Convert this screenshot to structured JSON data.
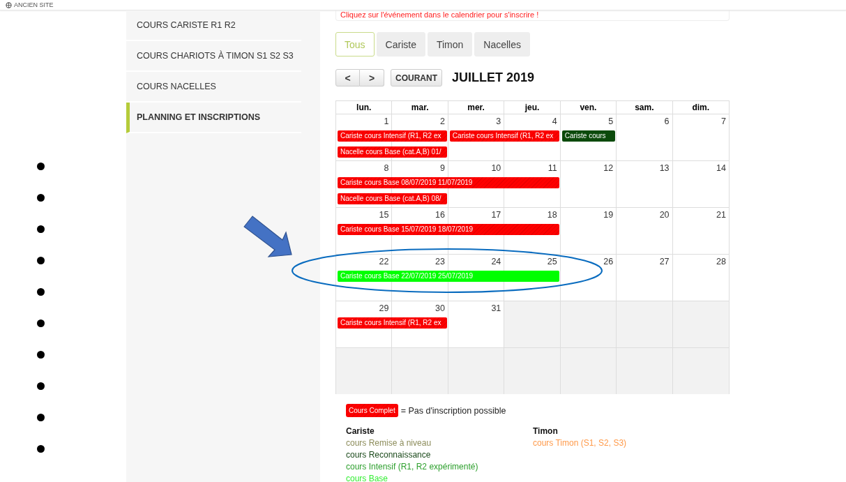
{
  "top_bar": {
    "link": "ANCIEN SITE"
  },
  "sidebar": {
    "items": [
      {
        "label": "COURS CARISTE R1 R2",
        "selected": false
      },
      {
        "label": "COURS CHARIOTS À TIMON S1 S2 S3",
        "selected": false
      },
      {
        "label": "COURS NACELLES",
        "selected": false
      },
      {
        "label": "PLANNING ET INSCRIPTIONS",
        "selected": true
      }
    ]
  },
  "notice": "Cliquez sur l'événement dans le calendrier pour s'inscrire !",
  "filters": [
    {
      "label": "Tous",
      "selected": true
    },
    {
      "label": "Cariste",
      "selected": false
    },
    {
      "label": "Timon",
      "selected": false
    },
    {
      "label": "Nacelles",
      "selected": false
    }
  ],
  "toolbar": {
    "prev": "<",
    "next": ">",
    "today": "COURANT",
    "title": "JUILLET 2019"
  },
  "calendar": {
    "weekdays": [
      "lun.",
      "mar.",
      "mer.",
      "jeu.",
      "ven.",
      "sam.",
      "dim."
    ],
    "weeks": [
      {
        "days": [
          {
            "number": "1",
            "events": [
              {
                "text": "Cariste cours Intensif (R1, R2 ex",
                "kind": "two_day",
                "color": "#ff0000",
                "full": true
              },
              {
                "text": "Nacelle cours Base (cat.A,B) 01/",
                "kind": "two_day",
                "color": "#ff0000",
                "full": true
              }
            ]
          },
          {
            "number": "2"
          },
          {
            "number": "3",
            "events": [
              {
                "text": "Cariste cours Intensif (R1, R2 ex",
                "kind": "two_day",
                "color": "#ff0000",
                "full": true
              }
            ]
          },
          {
            "number": "4"
          },
          {
            "number": "5",
            "events": [
              {
                "text": "Cariste cours",
                "kind": "one_day",
                "color": "#0b4a0b",
                "full": false
              }
            ]
          },
          {
            "number": "6"
          },
          {
            "number": "7"
          }
        ]
      },
      {
        "days": [
          {
            "number": "8",
            "events": [
              {
                "text": "Cariste cours Base 08/07/2019 11/07/2019",
                "kind": "four_day",
                "color": "#ff0000",
                "full": true
              },
              {
                "text": "Nacelle cours Base (cat.A,B) 08/",
                "kind": "two_day",
                "color": "#ff0000",
                "full": true
              }
            ]
          },
          {
            "number": "9"
          },
          {
            "number": "10"
          },
          {
            "number": "11"
          },
          {
            "number": "12"
          },
          {
            "number": "13"
          },
          {
            "number": "14"
          }
        ]
      },
      {
        "days": [
          {
            "number": "15",
            "events": [
              {
                "text": "Cariste cours Base 15/07/2019 18/07/2019",
                "kind": "four_day",
                "color": "#ff0000",
                "full": true
              }
            ]
          },
          {
            "number": "16"
          },
          {
            "number": "17"
          },
          {
            "number": "18"
          },
          {
            "number": "19"
          },
          {
            "number": "20"
          },
          {
            "number": "21"
          }
        ]
      },
      {
        "days": [
          {
            "number": "22",
            "events": [
              {
                "text": "Cariste cours Base 22/07/2019 25/07/2019",
                "kind": "four_day",
                "color": "#00ff00",
                "full": false
              }
            ]
          },
          {
            "number": "23"
          },
          {
            "number": "24"
          },
          {
            "number": "25"
          },
          {
            "number": "26"
          },
          {
            "number": "27"
          },
          {
            "number": "28"
          }
        ]
      },
      {
        "days": [
          {
            "number": "29",
            "events": [
              {
                "text": "Cariste cours Intensif (R1, R2 ex",
                "kind": "two_day",
                "color": "#ff0000",
                "full": true
              }
            ]
          },
          {
            "number": "30"
          },
          {
            "number": "31"
          },
          {
            "outside": true
          },
          {
            "outside": true
          },
          {
            "outside": true
          },
          {
            "outside": true
          }
        ]
      },
      {
        "days": [
          {
            "outside": true
          },
          {
            "outside": true
          },
          {
            "outside": true
          },
          {
            "outside": true
          },
          {
            "outside": true
          },
          {
            "outside": true
          },
          {
            "outside": true
          }
        ]
      }
    ]
  },
  "legend": {
    "badge": "Cours Complet",
    "badge_note": "= Pas d'inscription possible",
    "groups": [
      {
        "title": "Cariste",
        "items": [
          {
            "label": "cours Remise à niveau",
            "color": "#8c8c5a"
          },
          {
            "label": "cours Reconnaissance",
            "color": "#1b4a1b"
          },
          {
            "label": "cours Intensif (R1, R2 expérimenté)",
            "color": "#2ea02e"
          },
          {
            "label": "cours Base",
            "color": "#33ee33"
          }
        ]
      },
      {
        "title": "Timon",
        "items": [
          {
            "label": "cours Timon (S1, S2, S3)",
            "color": "#ff9a4a"
          }
        ]
      }
    ]
  }
}
